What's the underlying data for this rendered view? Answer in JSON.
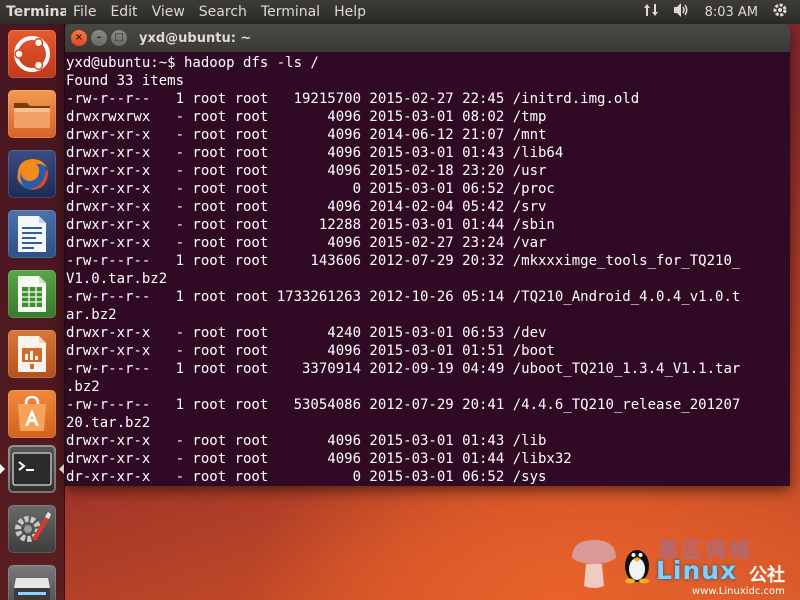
{
  "top_panel": {
    "app_name": "Terminal",
    "menu": [
      "File",
      "Edit",
      "View",
      "Search",
      "Terminal",
      "Help"
    ],
    "indicators": {
      "network_icon": "network-updown-icon",
      "volume_icon": "volume-icon",
      "clock": "8:03 AM",
      "power_icon": "power-gear-icon"
    }
  },
  "launcher": {
    "items": [
      {
        "name": "ubuntu-dash",
        "icon": "ubuntu-logo-icon"
      },
      {
        "name": "files",
        "icon": "folder-icon"
      },
      {
        "name": "firefox",
        "icon": "firefox-icon"
      },
      {
        "name": "libreoffice-writer",
        "icon": "writer-document-icon"
      },
      {
        "name": "libreoffice-calc",
        "icon": "calc-spreadsheet-icon"
      },
      {
        "name": "libreoffice-impress",
        "icon": "impress-presentation-icon"
      },
      {
        "name": "software-center",
        "icon": "shopping-bag-icon"
      },
      {
        "name": "terminal",
        "icon": "terminal-icon",
        "active": true
      },
      {
        "name": "system-settings",
        "icon": "settings-tools-icon"
      },
      {
        "name": "scanner",
        "icon": "scanner-icon"
      }
    ]
  },
  "terminal": {
    "title": "yxd@ubuntu: ~",
    "buttons": {
      "close": "×",
      "minimize": "–",
      "maximize": "□"
    },
    "lines": [
      "yxd@ubuntu:~$ hadoop dfs -ls /",
      "Found 33 items",
      "-rw-r--r--   1 root root   19215700 2015-02-27 22:45 /initrd.img.old",
      "drwxrwxrwx   - root root       4096 2015-03-01 08:02 /tmp",
      "drwxr-xr-x   - root root       4096 2014-06-12 21:07 /mnt",
      "drwxr-xr-x   - root root       4096 2015-03-01 01:43 /lib64",
      "drwxr-xr-x   - root root       4096 2015-02-18 23:20 /usr",
      "dr-xr-xr-x   - root root          0 2015-03-01 06:52 /proc",
      "drwxr-xr-x   - root root       4096 2014-02-04 05:42 /srv",
      "drwxr-xr-x   - root root      12288 2015-03-01 01:44 /sbin",
      "drwxr-xr-x   - root root       4096 2015-02-27 23:24 /var",
      "-rw-r--r--   1 root root     143606 2012-07-29 20:32 /mkxxximge_tools_for_TQ210_",
      "V1.0.tar.bz2",
      "-rw-r--r--   1 root root 1733261263 2012-10-26 05:14 /TQ210_Android_4.0.4_v1.0.t",
      "ar.bz2",
      "drwxr-xr-x   - root root       4240 2015-03-01 06:53 /dev",
      "drwxr-xr-x   - root root       4096 2015-03-01 01:51 /boot",
      "-rw-r--r--   1 root root    3370914 2012-09-19 04:49 /uboot_TQ210_1.3.4_V1.1.tar",
      ".bz2",
      "-rw-r--r--   1 root root   53054086 2012-07-29 20:41 /4.4.6_TQ210_release_201207",
      "20.tar.bz2",
      "drwxr-xr-x   - root root       4096 2015-03-01 01:43 /lib",
      "drwxr-xr-x   - root root       4096 2015-03-01 01:44 /libx32",
      "dr-xr-xr-x   - root root          0 2015-03-01 06:52 /sys"
    ]
  },
  "watermark": {
    "brand_top": "黑区网络",
    "brand": "Linux",
    "brand_cn": "公社",
    "domain": "www.Linuxidc.com"
  }
}
